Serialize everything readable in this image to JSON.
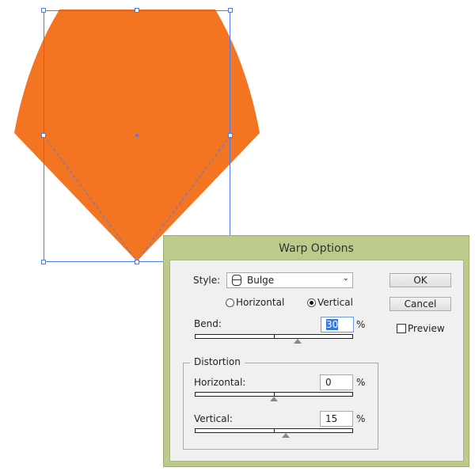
{
  "dialog": {
    "title": "Warp Options",
    "style_label": "Style:",
    "style_value": "Bulge",
    "style_icon": "bulge-icon",
    "orientation": {
      "horizontal": "Horizontal",
      "vertical": "Vertical",
      "selected": "Vertical"
    },
    "bend": {
      "label": "Bend:",
      "value": "30",
      "unit": "%",
      "percent": 30
    },
    "distortion": {
      "label": "Distortion",
      "horizontal": {
        "label": "Horizontal:",
        "value": "0",
        "unit": "%",
        "percent": 0
      },
      "vertical": {
        "label": "Vertical:",
        "value": "15",
        "unit": "%",
        "percent": 15
      }
    },
    "ok": "OK",
    "cancel": "Cancel",
    "preview": "Preview",
    "preview_checked": false
  },
  "colors": {
    "shape": "#f47521",
    "selection": "#4a7cf0",
    "dialog_frame": "#bccb8c"
  }
}
